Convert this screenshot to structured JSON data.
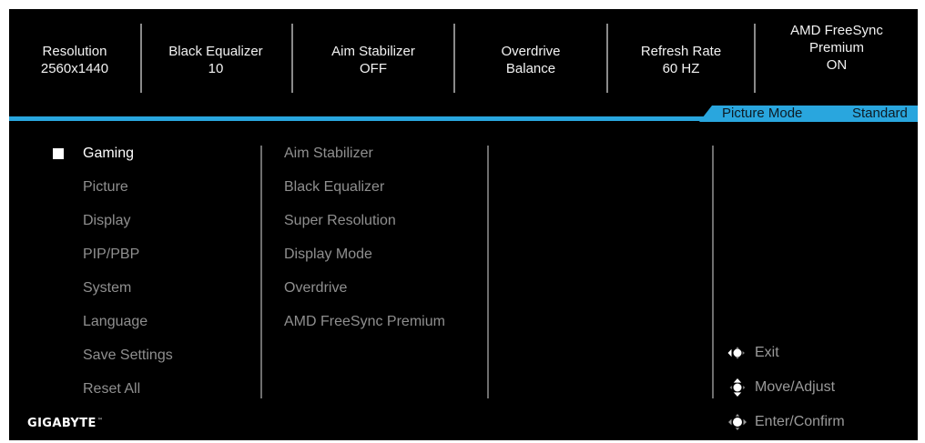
{
  "status_bar": [
    {
      "lines": [
        "Resolution",
        "2560x1440"
      ]
    },
    {
      "lines": [
        "Black Equalizer",
        "10"
      ]
    },
    {
      "lines": [
        "Aim Stabilizer",
        "OFF"
      ]
    },
    {
      "lines": [
        "Overdrive",
        "Balance"
      ]
    },
    {
      "lines": [
        "Refresh Rate",
        "60 HZ"
      ]
    },
    {
      "lines": [
        "AMD FreeSync",
        "Premium",
        "ON"
      ]
    }
  ],
  "mode_bar": {
    "label": "Picture Mode",
    "value": "Standard"
  },
  "main_menu": {
    "selected_index": 0,
    "items": [
      "Gaming",
      "Picture",
      "Display",
      "PIP/PBP",
      "System",
      "Language",
      "Save Settings",
      "Reset All"
    ]
  },
  "sub_menu": {
    "items": [
      "Aim Stabilizer",
      "Black Equalizer",
      "Super Resolution",
      "Display Mode",
      "Overdrive",
      "AMD FreeSync Premium"
    ]
  },
  "key_guide": [
    {
      "icon": "joystick-left-icon",
      "label": "Exit"
    },
    {
      "icon": "joystick-updown-icon",
      "label": "Move/Adjust"
    },
    {
      "icon": "joystick-press-icon",
      "label": "Enter/Confirm"
    }
  ],
  "logo": {
    "text": "GIGABYTE",
    "mark": "™"
  },
  "colors": {
    "accent": "#29a6de",
    "background": "#000000",
    "inactive_text": "#8f8f8f",
    "selected_text": "#ffffff"
  }
}
